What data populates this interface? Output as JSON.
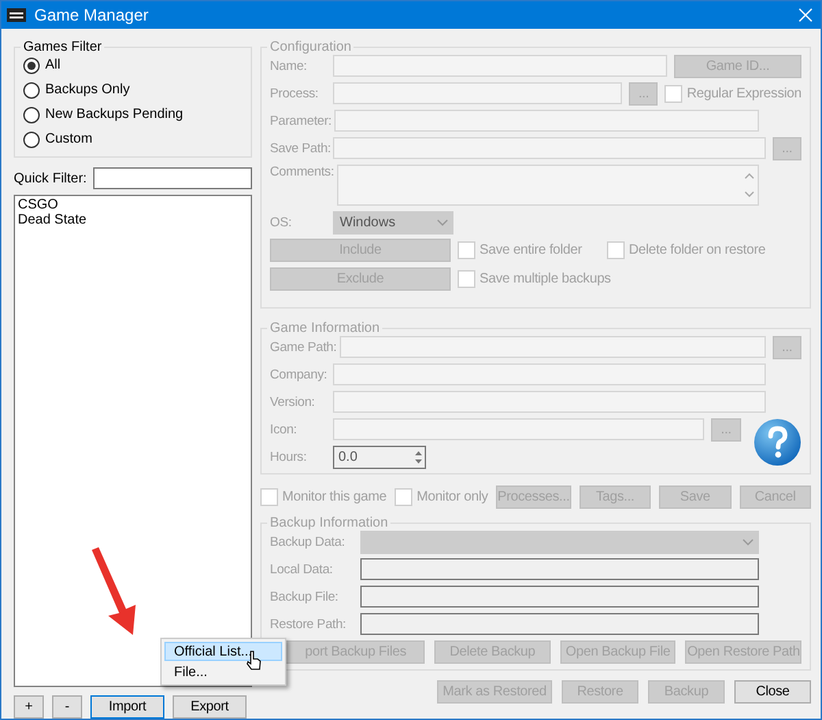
{
  "window": {
    "title": "Game Manager"
  },
  "games_filter": {
    "title": "Games Filter",
    "options": [
      {
        "label": "All",
        "selected": true
      },
      {
        "label": "Backups Only",
        "selected": false
      },
      {
        "label": "New Backups Pending",
        "selected": false
      },
      {
        "label": "Custom",
        "selected": false
      }
    ]
  },
  "quick_filter": {
    "label": "Quick Filter:"
  },
  "games": [
    "CSGO",
    "Dead State"
  ],
  "list_buttons": [
    {
      "label": "+",
      "focused": false
    },
    {
      "label": "-",
      "focused": false
    },
    {
      "label": "Import",
      "focused": true
    },
    {
      "label": "Export",
      "focused": false
    }
  ],
  "configuration": {
    "title": "Configuration",
    "name": {
      "label": "Name:",
      "button": "Game ID..."
    },
    "process": {
      "label": "Process:",
      "browse": "...",
      "checkbox": {
        "label": "Regular Expression",
        "checked": false
      }
    },
    "parameter": {
      "label": "Parameter:"
    },
    "save_path": {
      "label": "Save Path:",
      "browse": "..."
    },
    "comments": {
      "label": "Comments:"
    },
    "os": {
      "label": "OS:",
      "value": "Windows"
    },
    "buttons": [
      "Include",
      "Exclude"
    ],
    "options": [
      {
        "label": "Save entire folder",
        "checked": false
      },
      {
        "label": "Delete folder on restore",
        "checked": false
      },
      {
        "label": "Save multiple backups",
        "checked": false
      }
    ]
  },
  "game_information": {
    "title": "Game Information",
    "fields": [
      {
        "label": "Game Path:",
        "browse": "..."
      },
      {
        "label": "Company:"
      },
      {
        "label": "Version:"
      },
      {
        "label": "Icon:",
        "browse": "..."
      }
    ],
    "hours": {
      "label": "Hours:",
      "value": "0.0"
    }
  },
  "monitor": {
    "checkboxes": [
      {
        "label": "Monitor this game",
        "checked": false
      },
      {
        "label": "Monitor only",
        "checked": false
      }
    ],
    "buttons": [
      {
        "label": "Processes...",
        "disabled": true
      },
      {
        "label": "Tags...",
        "disabled": true
      },
      {
        "label": "Save",
        "disabled": true
      },
      {
        "label": "Cancel",
        "disabled": true
      }
    ]
  },
  "backup_information": {
    "title": "Backup Information",
    "combo_label": "Backup Data:",
    "fields": [
      "Local Data:",
      "Backup File:",
      "Restore Path:"
    ],
    "buttons": [
      {
        "label": "port Backup Files",
        "disabled": true
      },
      {
        "label": "Delete Backup",
        "disabled": true
      },
      {
        "label": "Open Backup File",
        "disabled": true
      },
      {
        "label": "Open Restore Path",
        "disabled": true
      }
    ]
  },
  "dialog_buttons": [
    {
      "label": "Mark as Restored",
      "disabled": true
    },
    {
      "label": "Restore",
      "disabled": true
    },
    {
      "label": "Backup",
      "disabled": true
    },
    {
      "label": "Close",
      "disabled": false
    }
  ],
  "import_menu": {
    "items": [
      {
        "label": "Official List...",
        "selected": true
      },
      {
        "label": "File...",
        "selected": false
      }
    ]
  }
}
